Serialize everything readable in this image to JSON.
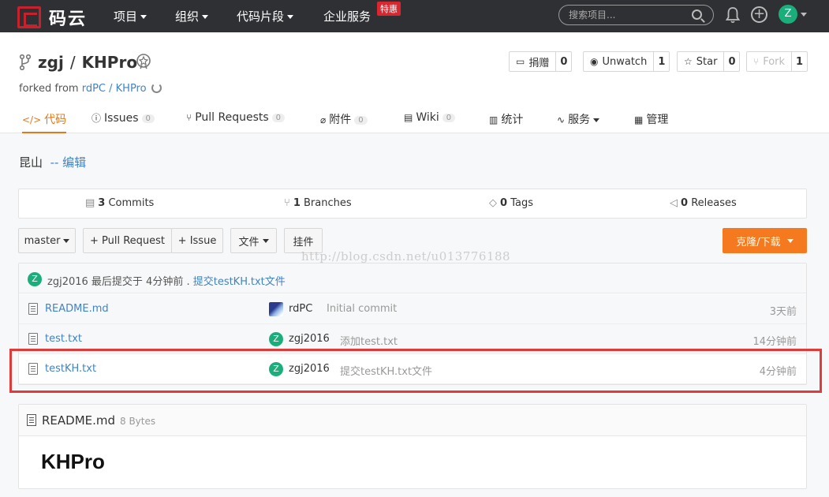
{
  "nav": {
    "logo_text": "码云",
    "items": [
      "项目",
      "组织",
      "代码片段",
      "企业服务"
    ],
    "promo_badge": "特惠",
    "search_placeholder": "搜索项目...",
    "user_initial": "Z"
  },
  "repo": {
    "owner": "zgj",
    "separator": "/",
    "name": "KHPro",
    "forked_prefix": "forked from ",
    "forked_from": "rdPC / KHPro"
  },
  "actions": {
    "donate": {
      "label": "捐赠",
      "count": "0"
    },
    "watch": {
      "label": "Unwatch",
      "count": "1"
    },
    "star": {
      "label": "Star",
      "count": "0"
    },
    "fork": {
      "label": "Fork",
      "count": "1"
    }
  },
  "tabs": {
    "code": "代码",
    "issues": {
      "label": "Issues",
      "count": "0"
    },
    "pulls": {
      "label": "Pull Requests",
      "count": "0"
    },
    "attachments": {
      "label": "附件",
      "count": "0"
    },
    "wiki": {
      "label": "Wiki",
      "count": "0"
    },
    "stats": "统计",
    "services": "服务",
    "manage": "管理"
  },
  "description": {
    "text": "昆山",
    "edit": "-- 编辑"
  },
  "stats": {
    "commits": {
      "count": "3",
      "label": "Commits"
    },
    "branches": {
      "count": "1",
      "label": "Branches"
    },
    "tags": {
      "count": "0",
      "label": "Tags"
    },
    "releases": {
      "count": "0",
      "label": "Releases"
    }
  },
  "toolbar": {
    "branch": "master",
    "pull_request": "+ Pull Request",
    "issue": "+ Issue",
    "file": "文件",
    "widget": "挂件",
    "clone": "克隆/下载"
  },
  "watermark": "http://blog.csdn.net/u013776188",
  "last_commit": {
    "avatar": "Z",
    "author": "zgj2016",
    "middle": " 最后提交于 4分钟前 . ",
    "message": "提交testKH.txt文件"
  },
  "files": [
    {
      "name": "README.md",
      "author": "rdPC",
      "message": "Initial commit",
      "time": "3天前",
      "avatar": ""
    },
    {
      "name": "test.txt",
      "author": "zgj2016",
      "message": "添加test.txt",
      "time": "14分钟前",
      "avatar": "Z"
    },
    {
      "name": "testKH.txt",
      "author": "zgj2016",
      "message": "提交testKH.txt文件",
      "time": "4分钟前",
      "avatar": "Z"
    }
  ],
  "readme": {
    "filename": "README.md",
    "size": "8 Bytes",
    "heading": "KHPro"
  },
  "colors": {
    "accent": "#e4781d",
    "clone_button": "#f5791f",
    "link": "#4183c4",
    "highlight_box": "#e03b3b",
    "avatar": "#1aae7b"
  }
}
